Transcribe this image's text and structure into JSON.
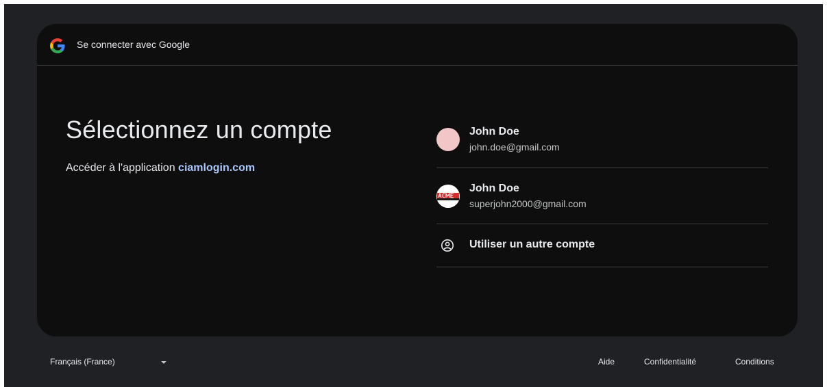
{
  "header": {
    "title": "Se connecter avec Google",
    "logo_icon": "google-g-icon"
  },
  "main": {
    "heading": "Sélectionnez un compte",
    "subtitle_prefix": "Accéder à l'application ",
    "app_name": "ciamlogin.com"
  },
  "accounts": [
    {
      "name": "John Doe",
      "email": "john.doe@gmail.com",
      "avatar": "pink-circle",
      "avatar_color": "#f2c6c6"
    },
    {
      "name": "John Doe",
      "email": "superjohn2000@gmail.com",
      "avatar": "acme-logo",
      "avatar_text": "ACME"
    }
  ],
  "other_account": {
    "label": "Utiliser un autre compte",
    "icon": "account-circle-icon"
  },
  "footer": {
    "language": "Français (France)",
    "help": "Aide",
    "privacy": "Confidentialité",
    "terms": "Conditions"
  },
  "colors": {
    "page_bg": "#202124",
    "card_bg": "#0e0e0f",
    "link": "#a8c7fa",
    "text": "#e8eaed",
    "divider": "#3c4043"
  }
}
